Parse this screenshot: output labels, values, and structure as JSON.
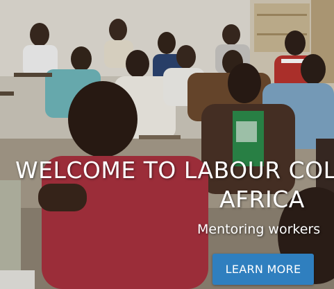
{
  "hero": {
    "title_line1": "WELCOME TO LABOUR COL",
    "title_line2": "AFRICA",
    "subtitle": "Mentoring workers",
    "button_label": "LEARN MORE"
  },
  "colors": {
    "button_bg": "#2f7fbf",
    "text": "#ffffff"
  }
}
